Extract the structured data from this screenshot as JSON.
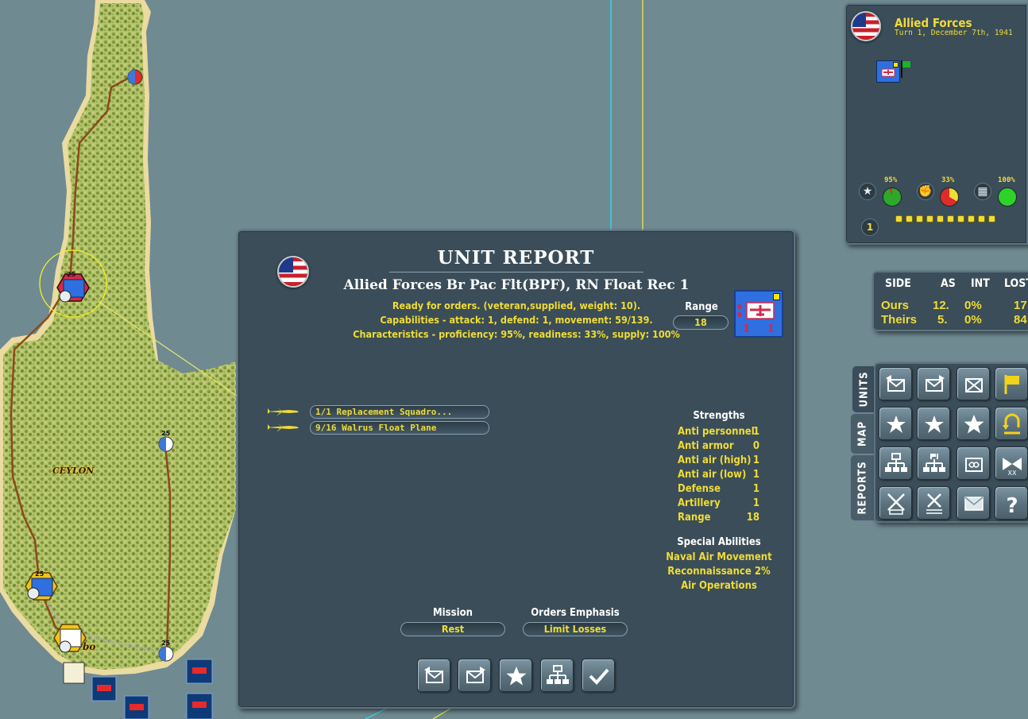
{
  "map": {
    "place_label": "CEYLON",
    "city_label_fragment": "bo",
    "hex_numbers": [
      "25",
      "25",
      "25",
      "25"
    ]
  },
  "forces_panel": {
    "title": "Allied Forces",
    "turn": "Turn 1, December 7th, 1941",
    "stats": [
      {
        "icon": "star-icon",
        "pct": "95%"
      },
      {
        "icon": "fist-icon",
        "pct": "33%"
      },
      {
        "icon": "fuel-can-icon",
        "pct": "100%"
      }
    ],
    "turn_badge": "1",
    "action_points": 10
  },
  "side_table": {
    "headers": [
      "SIDE",
      "AS",
      "INT",
      "LOST"
    ],
    "rows": [
      {
        "side": "Ours",
        "as": "12.",
        "int": "0%",
        "lost": "17"
      },
      {
        "side": "Theirs",
        "as": "5.",
        "int": "0%",
        "lost": "84"
      }
    ]
  },
  "command_panel": {
    "tabs": [
      "UNITS",
      "MAP",
      "REPORTS"
    ],
    "active_tab": "UNITS"
  },
  "unit_report": {
    "title": "UNIT REPORT",
    "unit_name": "Allied Forces Br Pac Flt(BPF), RN Float Rec 1",
    "status": "Ready for orders. (veteran,supplied, weight: 10).",
    "capabilities": "Capabilities - attack: 1, defend: 1, movement: 59/139.",
    "characteristics": "Characteristics - proficiency: 95%, readiness: 33%, supply: 100%",
    "range_label": "Range",
    "range_value": "18",
    "counter_numbers": [
      "1",
      "1"
    ],
    "squadrons": [
      "1/1 Replacement Squadro...",
      "9/16 Walrus Float Plane"
    ],
    "strengths_title": "Strengths",
    "strengths": [
      {
        "name": "Anti personnel",
        "value": "1"
      },
      {
        "name": "Anti armor",
        "value": "0"
      },
      {
        "name": "Anti air (high)",
        "value": "1"
      },
      {
        "name": "Anti air (low)",
        "value": "1"
      },
      {
        "name": "Defense",
        "value": "1"
      },
      {
        "name": "Artillery",
        "value": "1"
      },
      {
        "name": "Range",
        "value": "18"
      }
    ],
    "abilities_title": "Special Abilities",
    "abilities": [
      "Naval Air Movement",
      "Reconnaissance  2%",
      "Air Operations"
    ],
    "mission_label": "Mission",
    "mission_value": "Rest",
    "emphasis_label": "Orders Emphasis",
    "emphasis_value": "Limit Losses"
  },
  "colors": {
    "accent_yellow": "#f0dc36",
    "panel": "#3a4d58",
    "sea": "#6f8a91",
    "land": "#b4c26a",
    "unit_blue": "#2f6fe0",
    "unit_red": "#d52a48"
  }
}
